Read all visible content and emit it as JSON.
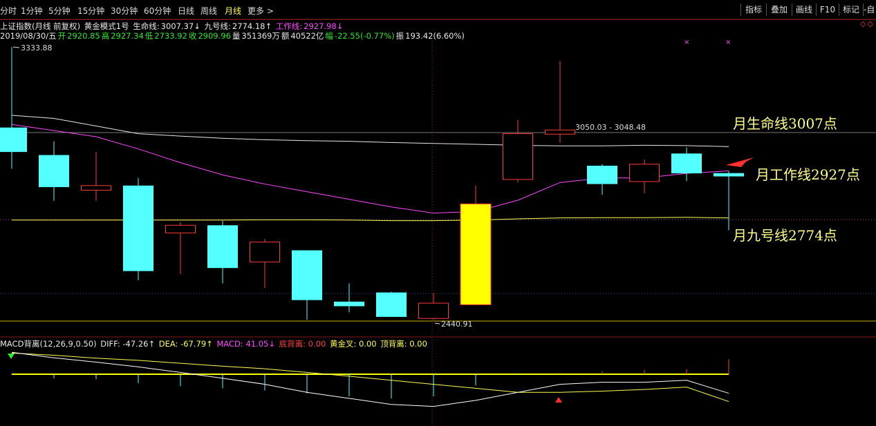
{
  "toolbar": {
    "periods": [
      "分时",
      "1分钟",
      "5分钟",
      "15分钟",
      "30分钟",
      "60分钟",
      "日线",
      "周线",
      "月线",
      "更多 >"
    ],
    "active_period": "月线",
    "right_buttons": [
      "指标",
      "叠加",
      "画线",
      "F10",
      "标记",
      "-自"
    ],
    "diamonds": "◇◇"
  },
  "info": {
    "title": "上证指数(月线 前复权)",
    "template": "黄金模式1号",
    "life_label": "生命线:",
    "life_value": "3007.37↓",
    "nine_label": "九号线:",
    "nine_value": "2774.18↑",
    "work_label": "工作线:",
    "work_value": "2927.98↓",
    "date": "2019/08/30/五",
    "open_label": "开",
    "open": "2920.85",
    "high_label": "高",
    "high": "2927.34",
    "low_label": "低",
    "low": "2733.92",
    "close_label": "收",
    "close": "2909.96",
    "vol_label": "量",
    "vol": "351369万",
    "amt_label": "额",
    "amt": "40522亿",
    "chg_label": "幅",
    "chg": "-22.55(-0.77%)",
    "amp_label": "振",
    "amp": "193.42(6.60%)"
  },
  "macd_info": {
    "name": "MACD背离(12,26,9,0.50)",
    "diff": "DIFF: -47.26↑",
    "dea": "DEA: -67.79↑",
    "macd": "MACD: 41.05↓",
    "bottom_div": "底背离: 0.00",
    "golden": "黄金叉: 0.00",
    "top_div": "顶背离: 0.00"
  },
  "annotations": {
    "life": "月生命线3007点",
    "work": "月工作线2927点",
    "nine": "月九号线2774点"
  },
  "colors": {
    "up": "#ff3b3b",
    "down": "#54ffff",
    "highlight": "#ffff00",
    "life_line": "#e8e8e8",
    "work_line": "#ff4bff",
    "nine_line": "#ffff54",
    "macd_diff": "#ffffff",
    "macd_dea": "#ffff54"
  },
  "chart_data": {
    "type": "candlestick",
    "y_scale": {
      "min": 2440.91,
      "max": 3333.88
    },
    "candles": [
      {
        "o": 3070,
        "h": 3333.88,
        "c": 2990,
        "l": 2935
      },
      {
        "o": 2980,
        "h": 3025,
        "c": 2875,
        "l": 2830
      },
      {
        "o": 2865,
        "h": 2990,
        "c": 2880,
        "l": 2830
      },
      {
        "o": 2880,
        "h": 2905,
        "c": 2600,
        "l": 2570
      },
      {
        "o": 2725,
        "h": 2760,
        "c": 2750,
        "l": 2590
      },
      {
        "o": 2750,
        "h": 2765,
        "c": 2610,
        "l": 2560
      },
      {
        "o": 2630,
        "h": 2705,
        "c": 2695,
        "l": 2545
      },
      {
        "o": 2668,
        "h": 2668,
        "c": 2505,
        "l": 2440.91
      },
      {
        "o": 2500,
        "h": 2560,
        "c": 2485,
        "l": 2465
      },
      {
        "o": 2530,
        "h": 2532,
        "c": 2450,
        "l": 2455
      },
      {
        "o": 2445,
        "h": 2528,
        "c": 2495,
        "l": 2440.91
      },
      {
        "o": 2490,
        "h": 2880,
        "c": 2820,
        "l": 2490
      },
      {
        "o": 2900,
        "h": 3095,
        "c": 3050.03,
        "l": 2890
      },
      {
        "o": 3048.48,
        "h": 3288,
        "c": 3062,
        "l": 3020
      },
      {
        "o": 2945,
        "h": 2950,
        "c": 2885,
        "l": 2850
      },
      {
        "o": 2893,
        "h": 2965,
        "c": 2950,
        "l": 2855
      },
      {
        "o": 2985,
        "h": 3005,
        "c": 2920,
        "l": 2895
      },
      {
        "o": 2920.85,
        "h": 2927.34,
        "c": 2909.96,
        "l": 2733.92
      }
    ],
    "highlight_index": 11,
    "life_line": [
      3110,
      3100,
      3075,
      3050,
      3042,
      3035,
      3030,
      3027,
      3025,
      3021,
      3018,
      3015,
      3012,
      3010,
      3010,
      3012,
      3011,
      3007.37
    ],
    "work_line": [
      3080,
      3060,
      3040,
      3000,
      2955,
      2915,
      2885,
      2860,
      2835,
      2810,
      2790,
      2795,
      2832,
      2890,
      2905,
      2905,
      2920,
      2927.98
    ],
    "nine_line": [
      2767,
      2767,
      2767,
      2767,
      2767,
      2767,
      2768,
      2768,
      2767,
      2765,
      2765,
      2767,
      2771,
      2774,
      2775,
      2775,
      2776,
      2774.18
    ],
    "max_label": "3333.88",
    "min_label": "2440.91",
    "range_label": "3050.03 - 3048.48",
    "macd": {
      "zero": 0,
      "y_range": [
        -120,
        70
      ],
      "diff": [
        60,
        45,
        33,
        20,
        5,
        -10,
        -25,
        -45,
        -60,
        -75,
        -80,
        -65,
        -45,
        -25,
        -20,
        -20,
        -15,
        -47.26
      ],
      "dea": [
        58,
        52,
        44,
        38,
        30,
        22,
        15,
        5,
        -5,
        -15,
        -25,
        -35,
        -45,
        -45,
        -42,
        -38,
        -32,
        -67.79
      ],
      "hist": [
        2,
        -10,
        -12,
        -22,
        -30,
        -35,
        -40,
        -48,
        -55,
        -60,
        -55,
        -28,
        -2,
        4,
        8,
        12,
        14,
        41.05
      ]
    }
  }
}
